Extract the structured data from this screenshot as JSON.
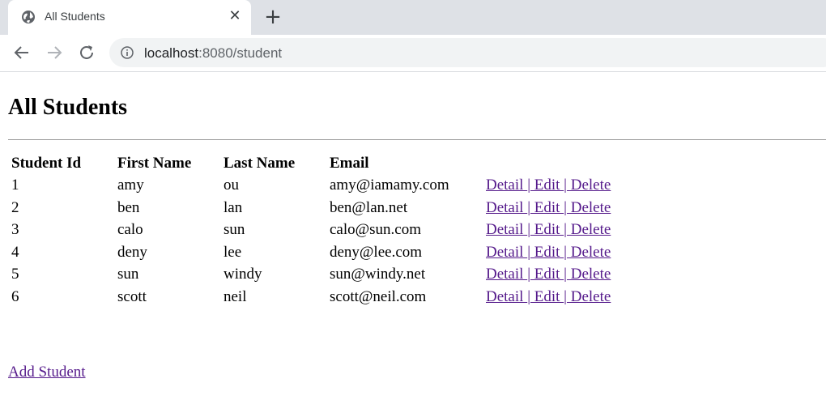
{
  "browser": {
    "tab_title": "All Students",
    "tab_close": "✕",
    "new_tab": "+",
    "url_host": "localhost",
    "url_path": ":8080/student"
  },
  "page": {
    "heading": "All Students",
    "columns": [
      "Student Id",
      "First Name",
      "Last Name",
      "Email"
    ],
    "rows": [
      {
        "id": "1",
        "first": "amy",
        "last": "ou",
        "email": "amy@iamamy.com"
      },
      {
        "id": "2",
        "first": "ben",
        "last": "lan",
        "email": "ben@lan.net"
      },
      {
        "id": "3",
        "first": "calo",
        "last": "sun",
        "email": "calo@sun.com"
      },
      {
        "id": "4",
        "first": "deny",
        "last": "lee",
        "email": "deny@lee.com"
      },
      {
        "id": "5",
        "first": "sun",
        "last": "windy",
        "email": "sun@windy.net"
      },
      {
        "id": "6",
        "first": "scott",
        "last": "neil",
        "email": "scott@neil.com"
      }
    ],
    "actions": {
      "detail": "Detail ",
      "sep": "|",
      "edit": " Edit ",
      "delete": " Delete"
    },
    "add_student": "Add Student"
  },
  "colors": {
    "visited_link": "#551a8b",
    "tabstrip": "#dee1e6",
    "omnibox": "#f1f3f4"
  }
}
